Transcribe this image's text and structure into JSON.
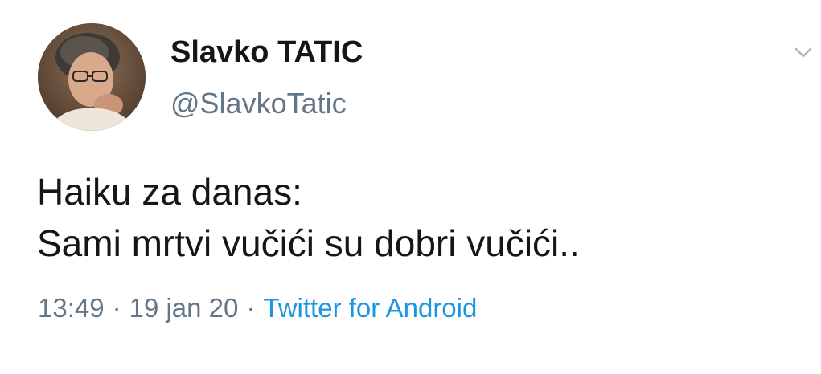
{
  "tweet": {
    "author": {
      "display_name": "Slavko TATIC",
      "handle": "@SlavkoTatic"
    },
    "text_lines": [
      "Haiku za danas:",
      "Sami mrtvi vučići su dobri vučići.."
    ],
    "time": "13:49",
    "date": "19 jan 20",
    "separator": "·",
    "source": "Twitter for Android",
    "colors": {
      "source_link": "#1b95e0",
      "secondary_text": "#657786"
    },
    "icons": {
      "menu": "chevron-down-icon"
    }
  }
}
